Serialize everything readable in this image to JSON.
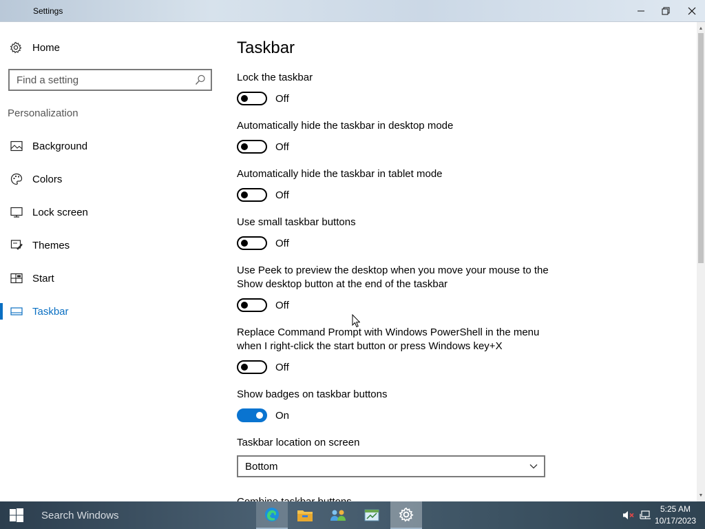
{
  "window": {
    "title": "Settings",
    "minimize": "—",
    "restore": "❐",
    "close": "✕"
  },
  "sidebar": {
    "home_label": "Home",
    "search_placeholder": "Find a setting",
    "section_label": "Personalization",
    "items": [
      {
        "label": "Background",
        "icon": "picture-icon"
      },
      {
        "label": "Colors",
        "icon": "palette-icon"
      },
      {
        "label": "Lock screen",
        "icon": "lock-screen-icon"
      },
      {
        "label": "Themes",
        "icon": "brush-icon"
      },
      {
        "label": "Start",
        "icon": "start-tiles-icon"
      },
      {
        "label": "Taskbar",
        "icon": "taskbar-icon",
        "active": true
      }
    ]
  },
  "main": {
    "title": "Taskbar",
    "settings": [
      {
        "label": "Lock the taskbar",
        "state": "Off",
        "on": false
      },
      {
        "label": "Automatically hide the taskbar in desktop mode",
        "state": "Off",
        "on": false
      },
      {
        "label": "Automatically hide the taskbar in tablet mode",
        "state": "Off",
        "on": false
      },
      {
        "label": "Use small taskbar buttons",
        "state": "Off",
        "on": false
      },
      {
        "label": "Use Peek to preview the desktop when you move your mouse to the Show desktop button at the end of the taskbar",
        "state": "Off",
        "on": false
      },
      {
        "label": "Replace Command Prompt with Windows PowerShell in the menu when I right-click the start button or press Windows key+X",
        "state": "Off",
        "on": false
      },
      {
        "label": "Show badges on taskbar buttons",
        "state": "On",
        "on": true
      }
    ],
    "location_label": "Taskbar location on screen",
    "location_value": "Bottom",
    "next_label_partial": "Combine taskbar buttons"
  },
  "taskbar": {
    "search_text": "Search Windows",
    "apps": [
      "edge-icon",
      "file-explorer-icon",
      "people-app-icon",
      "spreadsheet-app-icon",
      "settings-gear-icon"
    ],
    "time": "5:25 AM",
    "date": "10/17/2023"
  },
  "colors": {
    "accent": "#0a74d0",
    "active_nav_text": "#0a6fc2",
    "taskbar_bg": "#3d5363"
  }
}
